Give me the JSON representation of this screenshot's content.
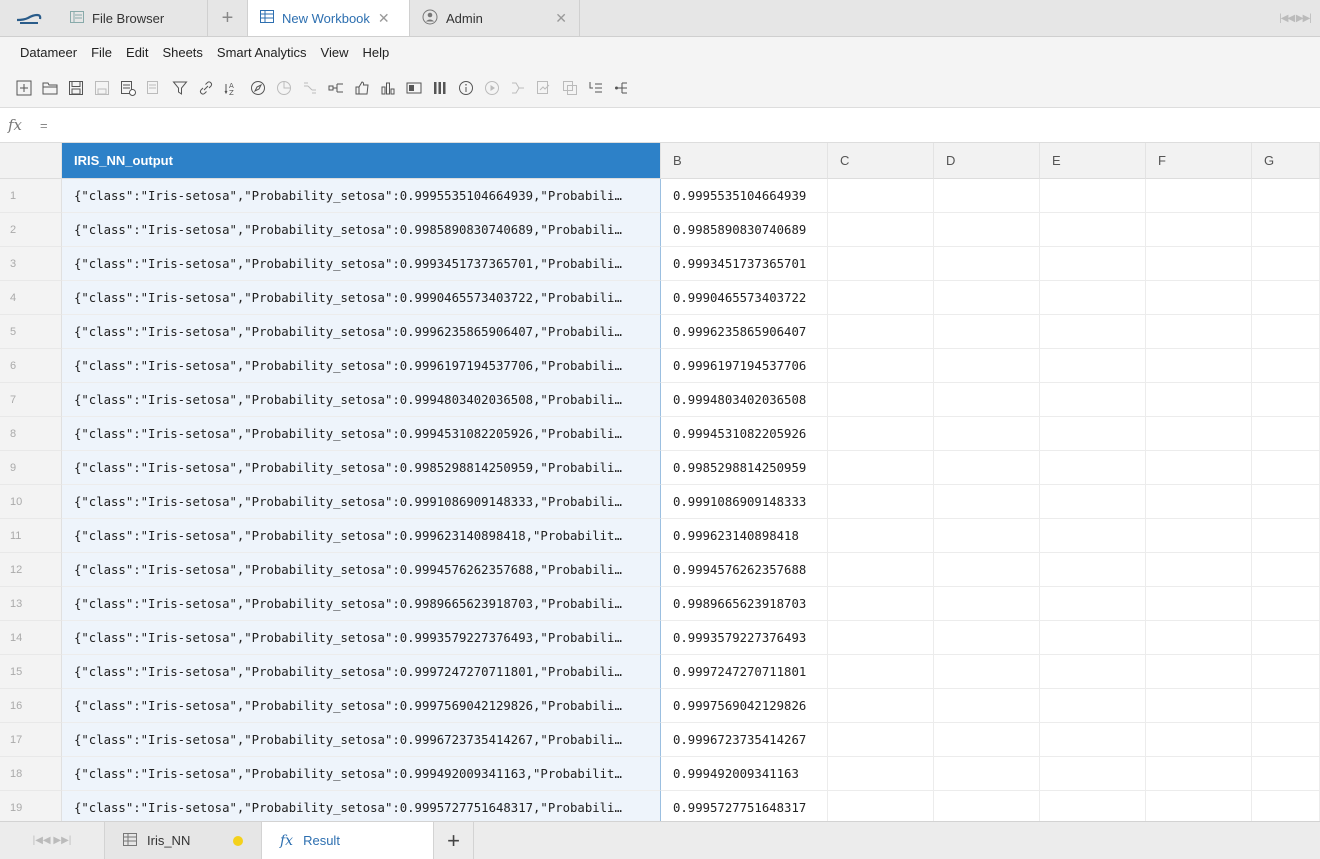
{
  "tabs": [
    {
      "label": "File Browser",
      "icon": "file-browser-icon"
    },
    {
      "label": "New Workbook",
      "icon": "workbook-icon",
      "active": true
    },
    {
      "label": "Admin",
      "icon": "user-icon"
    }
  ],
  "menu": [
    "Datameer",
    "File",
    "Edit",
    "Sheets",
    "Smart Analytics",
    "View",
    "Help"
  ],
  "formula": {
    "value": "="
  },
  "columns": [
    "IRIS_NN_output",
    "B",
    "C",
    "D",
    "E",
    "F",
    "G"
  ],
  "rows": [
    {
      "n": "1",
      "a": "{\"class\":\"Iris-setosa\",\"Probability_setosa\":0.9995535104664939,\"Probabili…",
      "b": "0.9995535104664939"
    },
    {
      "n": "2",
      "a": "{\"class\":\"Iris-setosa\",\"Probability_setosa\":0.9985890830740689,\"Probabili…",
      "b": "0.9985890830740689"
    },
    {
      "n": "3",
      "a": "{\"class\":\"Iris-setosa\",\"Probability_setosa\":0.9993451737365701,\"Probabili…",
      "b": "0.9993451737365701"
    },
    {
      "n": "4",
      "a": "{\"class\":\"Iris-setosa\",\"Probability_setosa\":0.9990465573403722,\"Probabili…",
      "b": "0.9990465573403722"
    },
    {
      "n": "5",
      "a": "{\"class\":\"Iris-setosa\",\"Probability_setosa\":0.9996235865906407,\"Probabili…",
      "b": "0.9996235865906407"
    },
    {
      "n": "6",
      "a": "{\"class\":\"Iris-setosa\",\"Probability_setosa\":0.9996197194537706,\"Probabili…",
      "b": "0.9996197194537706"
    },
    {
      "n": "7",
      "a": "{\"class\":\"Iris-setosa\",\"Probability_setosa\":0.9994803402036508,\"Probabili…",
      "b": "0.9994803402036508"
    },
    {
      "n": "8",
      "a": "{\"class\":\"Iris-setosa\",\"Probability_setosa\":0.9994531082205926,\"Probabili…",
      "b": "0.9994531082205926"
    },
    {
      "n": "9",
      "a": "{\"class\":\"Iris-setosa\",\"Probability_setosa\":0.9985298814250959,\"Probabili…",
      "b": "0.9985298814250959"
    },
    {
      "n": "10",
      "a": "{\"class\":\"Iris-setosa\",\"Probability_setosa\":0.9991086909148333,\"Probabili…",
      "b": "0.9991086909148333"
    },
    {
      "n": "11",
      "a": "{\"class\":\"Iris-setosa\",\"Probability_setosa\":0.999623140898418,\"Probabilit…",
      "b": "0.999623140898418"
    },
    {
      "n": "12",
      "a": "{\"class\":\"Iris-setosa\",\"Probability_setosa\":0.9994576262357688,\"Probabili…",
      "b": "0.9994576262357688"
    },
    {
      "n": "13",
      "a": "{\"class\":\"Iris-setosa\",\"Probability_setosa\":0.9989665623918703,\"Probabili…",
      "b": "0.9989665623918703"
    },
    {
      "n": "14",
      "a": "{\"class\":\"Iris-setosa\",\"Probability_setosa\":0.9993579227376493,\"Probabili…",
      "b": "0.9993579227376493"
    },
    {
      "n": "15",
      "a": "{\"class\":\"Iris-setosa\",\"Probability_setosa\":0.9997247270711801,\"Probabili…",
      "b": "0.9997247270711801"
    },
    {
      "n": "16",
      "a": "{\"class\":\"Iris-setosa\",\"Probability_setosa\":0.9997569042129826,\"Probabili…",
      "b": "0.9997569042129826"
    },
    {
      "n": "17",
      "a": "{\"class\":\"Iris-setosa\",\"Probability_setosa\":0.9996723735414267,\"Probabili…",
      "b": "0.9996723735414267"
    },
    {
      "n": "18",
      "a": "{\"class\":\"Iris-setosa\",\"Probability_setosa\":0.999492009341163,\"Probabilit…",
      "b": "0.999492009341163"
    },
    {
      "n": "19",
      "a": "{\"class\":\"Iris-setosa\",\"Probability_setosa\":0.9995727751648317,\"Probabili…",
      "b": "0.9995727751648317"
    }
  ],
  "sheets": [
    {
      "label": "Iris_NN",
      "icon": "sheet-grid-icon",
      "status": "pending-dot"
    },
    {
      "label": "Result",
      "icon": "fx-icon",
      "active": true
    }
  ],
  "colors": {
    "accent": "#2d81c8",
    "tab_active_text": "#2d6fb0",
    "status_dot": "#f4d11b"
  }
}
